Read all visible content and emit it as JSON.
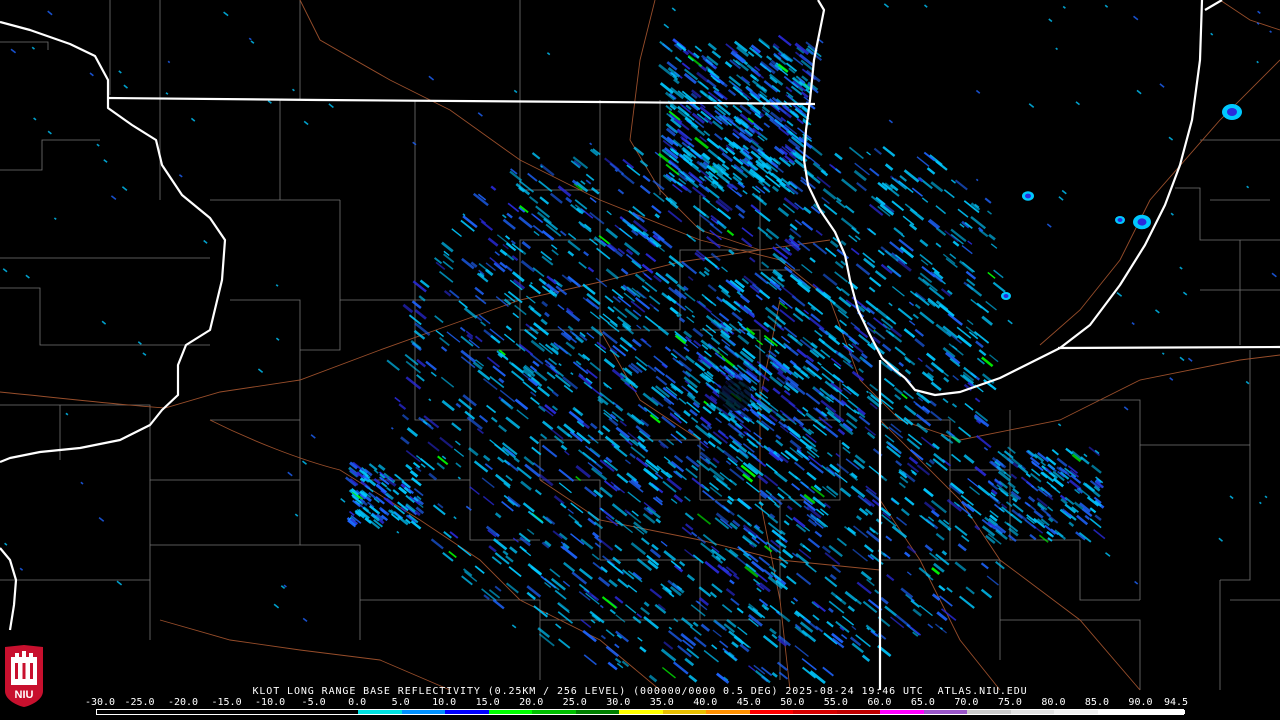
{
  "product_caption": "KLOT LONG RANGE BASE REFLECTIVITY (0.25KM / 256 LEVEL) (000000/0000 0.5 DEG) 2025-08-24 19:46 UTC  ATLAS.NIU.EDU",
  "logo": {
    "text": "NIU",
    "icon": "niu-logo-icon",
    "red": "#c8102e",
    "white": "#ffffff"
  },
  "colorbar": {
    "ticks": [
      "-30.0",
      "-25.0",
      "-20.0",
      "-15.0",
      "-10.0",
      "-5.0",
      "0.0",
      "5.0",
      "10.0",
      "15.0",
      "20.0",
      "25.0",
      "30.0",
      "35.0",
      "40.0",
      "45.0",
      "50.0",
      "55.0",
      "60.0",
      "65.0",
      "70.0",
      "75.0",
      "80.0",
      "85.0",
      "90.0",
      "94.5"
    ],
    "segment_colors": [
      "#000000",
      "#000000",
      "#000000",
      "#000000",
      "#000000",
      "#000000",
      "#00e0e0",
      "#0090ff",
      "#0000ff",
      "#00ff00",
      "#00c000",
      "#008000",
      "#ffff00",
      "#e7c000",
      "#ff9000",
      "#ff0000",
      "#d60000",
      "#c00000",
      "#ff00ff",
      "#9955c9",
      "#c8c8c8",
      "#e0e0e0",
      "#f0f0f0",
      "#ffffff",
      "#ffffff"
    ]
  },
  "map_colors": {
    "background": "#000000",
    "state_borders": "#ffffff",
    "county_lines": "#8a8a8a",
    "highways": "#a0522d",
    "echo_light": "#00c8ff",
    "echo_mid": "#1e64ff",
    "echo_strong": "#2a2adc",
    "echo_green": "#00ff00"
  },
  "radar": {
    "site": "KLOT",
    "range_rings": "none"
  }
}
